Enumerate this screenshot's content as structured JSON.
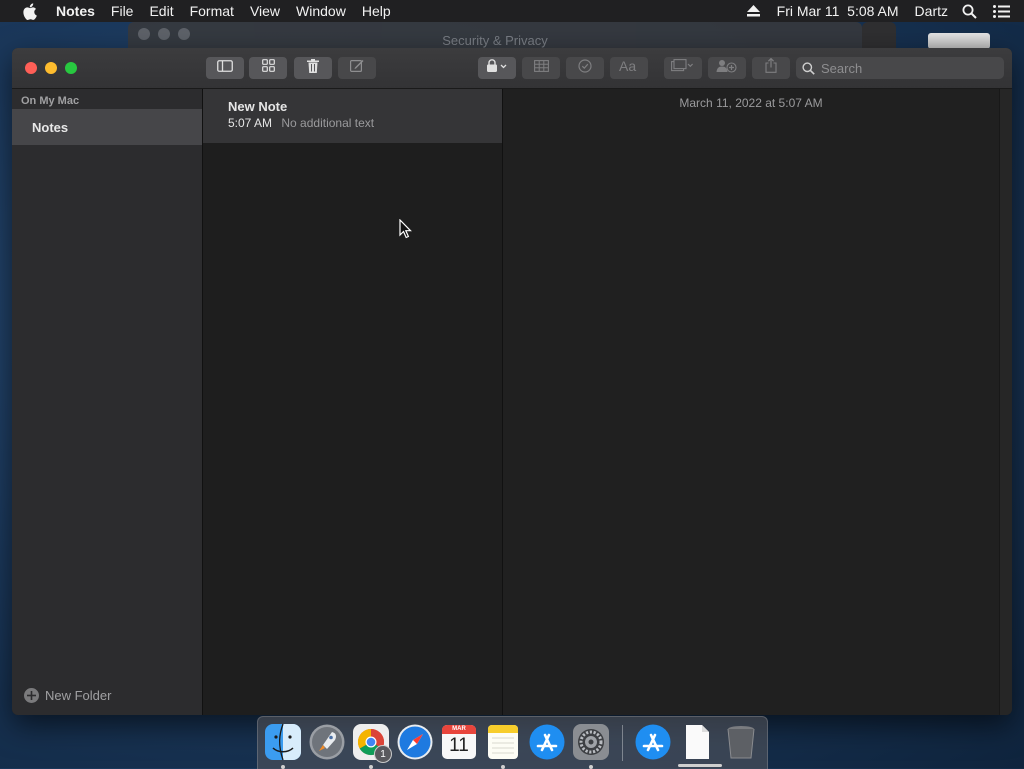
{
  "menubar": {
    "app_name": "Notes",
    "menus": [
      "File",
      "Edit",
      "Format",
      "View",
      "Window",
      "Help"
    ],
    "clock": "Fri Mar 11  5:08 AM",
    "user": "Dartz"
  },
  "background_window": {
    "title": "Security & Privacy"
  },
  "toolbar": {
    "search_placeholder": "Search"
  },
  "sidebar": {
    "section_label": "On My Mac",
    "folders": [
      {
        "label": "Notes",
        "selected": true
      }
    ],
    "new_folder_label": "New Folder"
  },
  "note_list": {
    "notes": [
      {
        "title": "New Note",
        "time": "5:07 AM",
        "preview": "No additional text",
        "selected": true
      }
    ]
  },
  "editor": {
    "date": "March 11, 2022 at 5:07 AM"
  },
  "dock": {
    "apps": [
      "finder-icon",
      "launchpad-icon",
      "chrome-icon",
      "safari-icon",
      "calendar-icon",
      "notes-icon",
      "app-store-icon",
      "system-preferences-icon",
      "app-store-download-icon",
      "document-icon",
      "trash-icon"
    ],
    "calendar_month": "MAR",
    "calendar_day": "11",
    "chrome_badge": "1"
  },
  "colors": {
    "menubar_bg": "#202022",
    "window_bg": "#1f1f1f",
    "sidebar_bg": "#2c2c2e",
    "selected_row": "#353537",
    "close": "#ff5f57",
    "minimize": "#febc2e",
    "zoom": "#28c840"
  }
}
